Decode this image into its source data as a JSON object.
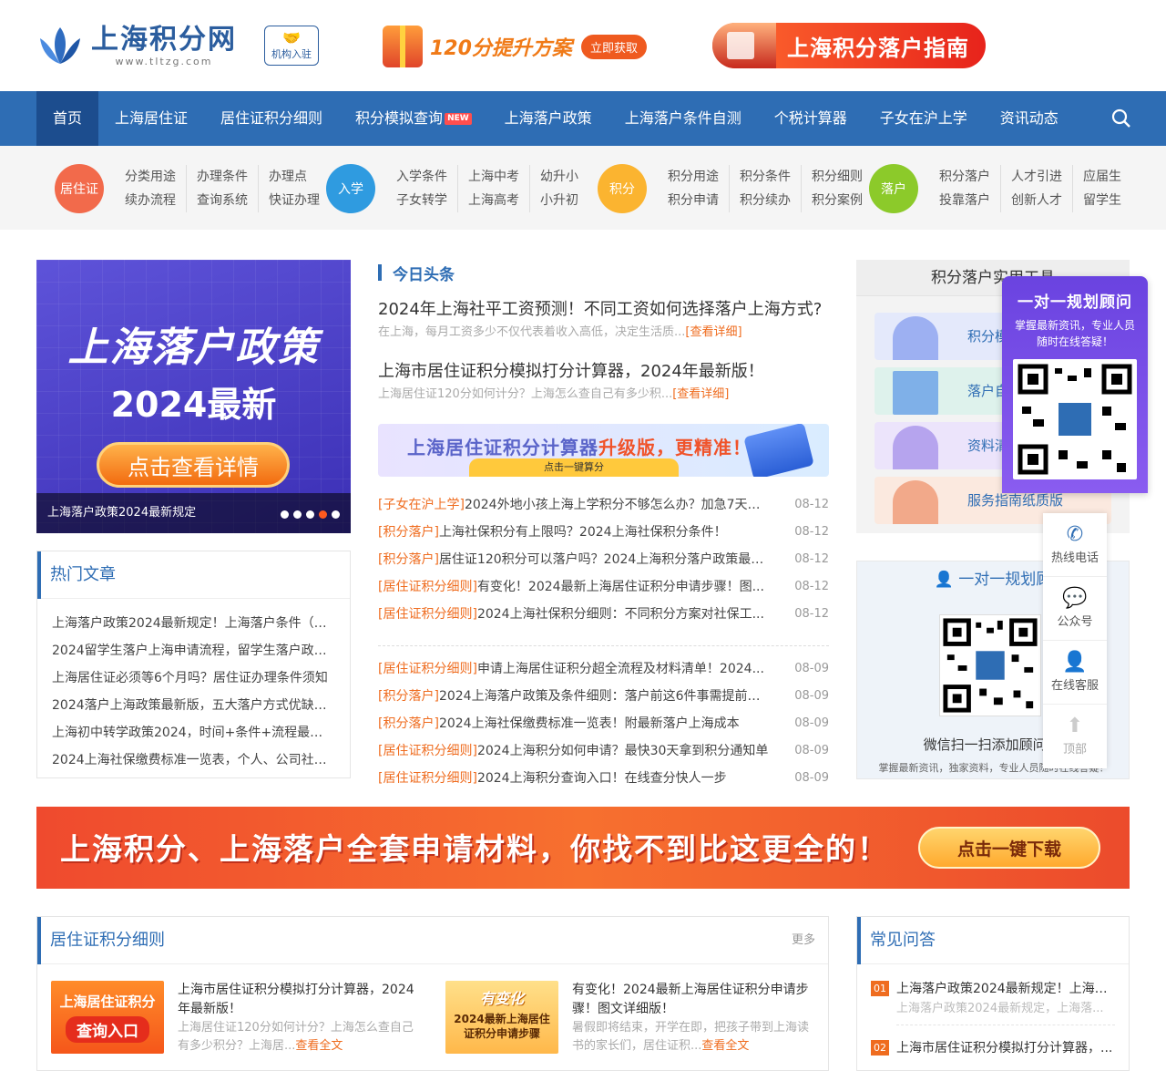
{
  "header": {
    "logo_title": "上海积分网",
    "logo_url": "www.tltzg.com",
    "org_button": "机构入驻",
    "promo1_text": "120分提升方案",
    "promo1_button": "立即获取",
    "promo2_text": "上海积分落户指南"
  },
  "nav": {
    "items": [
      "首页",
      "上海居住证",
      "居住证积分细则",
      "积分模拟查询",
      "上海落户政策",
      "上海落户条件自测",
      "个税计算器",
      "子女在沪上学",
      "资讯动态"
    ],
    "new_badge": "NEW"
  },
  "categories": [
    {
      "badge": "居住证",
      "color": "#f26a4b",
      "links": [
        "分类用途",
        "续办流程",
        "办理条件",
        "查询系统",
        "办理点",
        "快证办理"
      ]
    },
    {
      "badge": "入学",
      "color": "#2f9be0",
      "links": [
        "入学条件",
        "子女转学",
        "上海中考",
        "上海高考",
        "幼升小",
        "小升初"
      ]
    },
    {
      "badge": "积分",
      "color": "#fbb430",
      "links": [
        "积分用途",
        "积分申请",
        "积分条件",
        "积分续办",
        "积分细则",
        "积分案例"
      ]
    },
    {
      "badge": "落户",
      "color": "#8cca2a",
      "links": [
        "积分落户",
        "投靠落户",
        "人才引进",
        "创新人才",
        "应届生",
        "留学生"
      ]
    }
  ],
  "banner": {
    "line1": "上海落户政策",
    "line2": "2024最新",
    "button": "点击查看详情",
    "caption": "上海落户政策2024最新规定"
  },
  "hot": {
    "title": "热门文章",
    "items": [
      "上海落户政策2024最新规定！上海落户条件（史…",
      "2024留学生落户上海申请流程，留学生落户政策…",
      "上海居住证必须等6个月吗？居住证办理条件须知",
      "2024落户上海政策最新版，五大落户方式优缺点…",
      "上海初中转学政策2024，时间+条件+流程最全讲…",
      "2024上海社保缴费标准一览表，个人、公司社保…"
    ]
  },
  "today": {
    "title": "今日头条",
    "headlines": [
      {
        "title": "2024年上海社平工资预测！不同工资如何选择落户上海方式?",
        "summary": "在上海，每月工资多少不仅代表着收入高低，决定生活质...",
        "link": "[查看详细]"
      },
      {
        "title": "上海市居住证积分模拟打分计算器，2024年最新版！",
        "summary": "上海居住证120分如何计分？上海怎么查自己有多少积...",
        "link": "[查看详细]"
      }
    ],
    "calc_banner_a": "上海居住证积分计算器",
    "calc_banner_b": "升级版，更精准！",
    "calc_banner_sub": "点击一键算分",
    "news1": [
      {
        "cat": "[子女在沪上学]",
        "title": "2024外地小孩上海上学积分不够怎么办？加急7天可...",
        "date": "08-12"
      },
      {
        "cat": "[积分落户]",
        "title": "上海社保积分有上限吗？2024上海社保积分条件！",
        "date": "08-12"
      },
      {
        "cat": "[积分落户]",
        "title": "居住证120积分可以落户吗？2024上海积分落户政策最新！",
        "date": "08-12"
      },
      {
        "cat": "[居住证积分细则]",
        "title": "有变化！2024最新上海居住证积分申请步骤！图...",
        "date": "08-12"
      },
      {
        "cat": "[居住证积分细则]",
        "title": "2024上海社保积分细则：不同积分方案对社保工...",
        "date": "08-12"
      }
    ],
    "news2": [
      {
        "cat": "[居住证积分细则]",
        "title": "申请上海居住证积分超全流程及材料清单！2024...",
        "date": "08-09"
      },
      {
        "cat": "[积分落户]",
        "title": "2024上海落户政策及条件细则：落户前这6件事需提前准...",
        "date": "08-09"
      },
      {
        "cat": "[积分落户]",
        "title": "2024上海社保缴费标准一览表！附最新落户上海成本",
        "date": "08-09"
      },
      {
        "cat": "[居住证积分细则]",
        "title": "2024上海积分如何申请？最快30天拿到积分通知单",
        "date": "08-09"
      },
      {
        "cat": "[居住证积分细则]",
        "title": "2024上海积分查询入口！在线查分快人一步",
        "date": "08-09"
      }
    ]
  },
  "tools": {
    "title": "积分落户实用工具",
    "items": [
      "积分模",
      "落户自",
      "资料清",
      "服务指南纸质版"
    ]
  },
  "consult": {
    "title": "一对一规划顾",
    "line1": "微信扫一扫添加顾问 免",
    "line2": "掌握最新资讯，独家资料，专业人员随时在线答疑！"
  },
  "planner": {
    "title": "一对一规划顾问",
    "desc": "掌握最新资讯，专业人员随时在线答疑！"
  },
  "sidebar": {
    "items": [
      "热线电话",
      "公众号",
      "在线客服",
      "顶部"
    ]
  },
  "big_banner": {
    "text": "上海积分、上海落户全套申请材料，你找不到比这更全的！",
    "button": "点击一键下载"
  },
  "rules": {
    "title": "居住证积分细则",
    "more": "更多",
    "items": [
      {
        "img_line1": "上海居住证积分",
        "img_line2": "查询入口",
        "title": "上海市居住证积分模拟打分计算器，2024年最新版！",
        "summary": "上海居住证120分如何计分？上海怎么查自己有多少积分？上海居...",
        "link": "查看全文"
      },
      {
        "img_line1": "有变化",
        "img_line2": "2024最新上海居住证积分申请步骤",
        "title": "有变化！2024最新上海居住证积分申请步骤！图文详细版！",
        "summary": "暑假即将结束，开学在即，把孩子带到上海读书的家长们，居住证积...",
        "link": "查看全文"
      }
    ]
  },
  "faq": {
    "title": "常见问答",
    "items": [
      {
        "num": "01",
        "q": "上海落户政策2024最新规定！上海落户条件...",
        "a": "上海落户政策2024最新规定，上海落..."
      },
      {
        "num": "02",
        "q": "上海市居住证积分模拟打分计算器，...",
        "a": ""
      }
    ]
  }
}
